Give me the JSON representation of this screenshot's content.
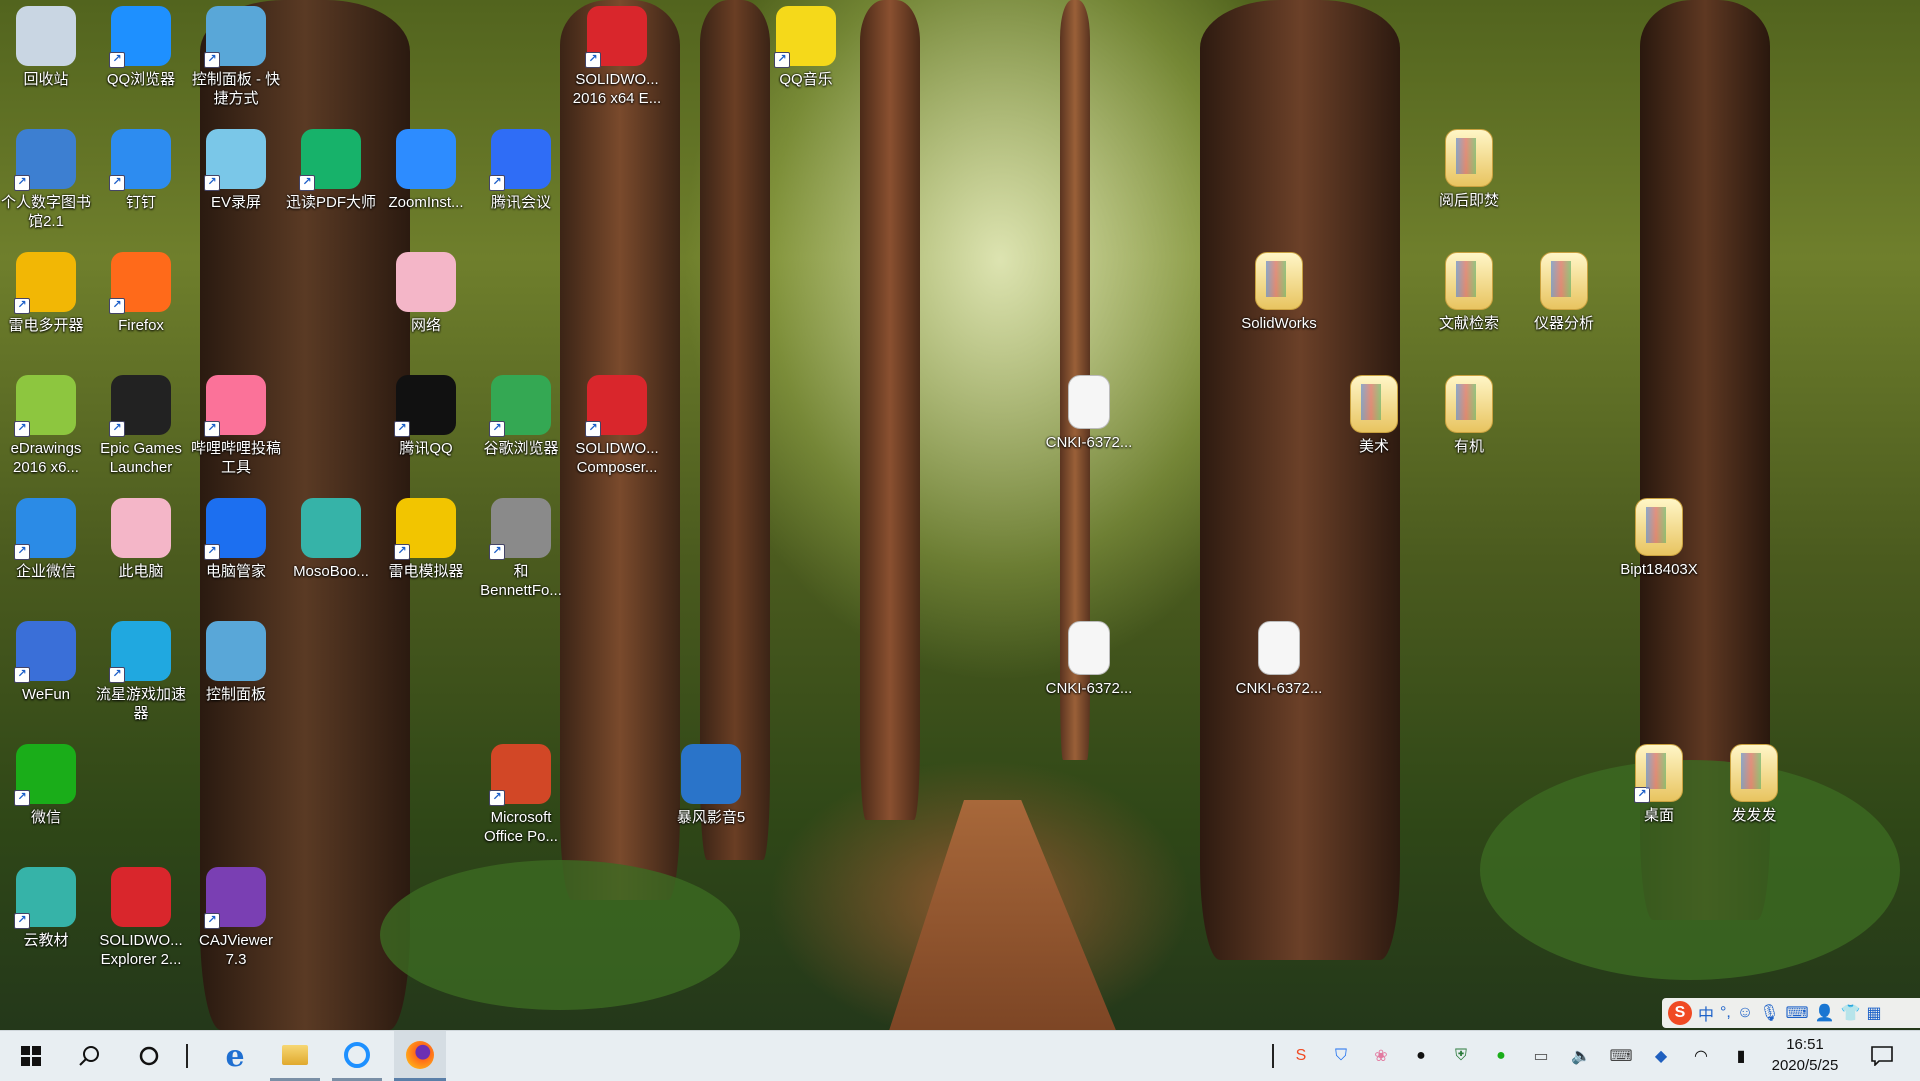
{
  "desktop": {
    "icons": [
      {
        "label": "回收站",
        "icon": "recycle-bin-icon",
        "color": "#c9d6e3",
        "shortcut": false
      },
      {
        "label": "QQ浏览器",
        "icon": "qq-browser-icon",
        "color": "#1e90ff",
        "shortcut": true
      },
      {
        "label": "控制面板 - 快捷方式",
        "icon": "control-panel-icon",
        "color": "#59a7d8",
        "shortcut": true
      },
      {
        "label": "SOLIDWO... 2016 x64 E...",
        "icon": "solidworks-icon",
        "color": "#d9262c",
        "shortcut": true
      },
      {
        "label": "QQ音乐",
        "icon": "qq-music-icon",
        "color": "#f5d91a",
        "shortcut": true
      },
      {
        "label": "个人数字图书馆2.1",
        "icon": "digital-library-icon",
        "color": "#3d7fd1",
        "shortcut": true
      },
      {
        "label": "钉钉",
        "icon": "dingtalk-icon",
        "color": "#2d8cf0",
        "shortcut": true
      },
      {
        "label": "EV录屏",
        "icon": "ev-recorder-icon",
        "color": "#7ac7e8",
        "shortcut": true
      },
      {
        "label": "迅读PDF大师",
        "icon": "pdf-reader-icon",
        "color": "#17b26a",
        "shortcut": true
      },
      {
        "label": "ZoomInst...",
        "icon": "zoom-icon",
        "color": "#2d8cff",
        "shortcut": false
      },
      {
        "label": "腾讯会议",
        "icon": "tencent-meeting-icon",
        "color": "#2f6df6",
        "shortcut": true
      },
      {
        "label": "阅后即焚",
        "icon": "folder-icon",
        "color": "#e8c460",
        "shortcut": false
      },
      {
        "label": "雷电多开器",
        "icon": "ldplayer-multi-icon",
        "color": "#f2b705",
        "shortcut": true
      },
      {
        "label": "Firefox",
        "icon": "firefox-icon",
        "color": "#ff6a1a",
        "shortcut": true
      },
      {
        "label": "网络",
        "icon": "network-anime-icon",
        "color": "#f4b6c8",
        "shortcut": false
      },
      {
        "label": "SolidWorks",
        "icon": "folder-icon",
        "color": "#e8c460",
        "shortcut": false
      },
      {
        "label": "文献检索",
        "icon": "folder-icon",
        "color": "#e8c460",
        "shortcut": false
      },
      {
        "label": "仪器分析",
        "icon": "folder-icon",
        "color": "#e8c460",
        "shortcut": false
      },
      {
        "label": "eDrawings 2016 x6...",
        "icon": "edrawings-icon",
        "color": "#8dc63f",
        "shortcut": true
      },
      {
        "label": "Epic Games Launcher",
        "icon": "epic-games-icon",
        "color": "#222222",
        "shortcut": true
      },
      {
        "label": "哔哩哔哩投稿工具",
        "icon": "bilibili-icon",
        "color": "#fb7299",
        "shortcut": true
      },
      {
        "label": "腾讯QQ",
        "icon": "qq-penguin-icon",
        "color": "#111111",
        "shortcut": true
      },
      {
        "label": "谷歌浏览器",
        "icon": "chrome-icon",
        "color": "#34a853",
        "shortcut": true
      },
      {
        "label": "SOLIDWO... Composer...",
        "icon": "solidworks-composer-icon",
        "color": "#d9262c",
        "shortcut": true
      },
      {
        "label": "CNKI-6372...",
        "icon": "document-icon",
        "color": "#f6f6f6",
        "shortcut": false
      },
      {
        "label": "美术",
        "icon": "folder-icon",
        "color": "#e8c460",
        "shortcut": false
      },
      {
        "label": "有机",
        "icon": "folder-icon",
        "color": "#e8c460",
        "shortcut": false
      },
      {
        "label": "企业微信",
        "icon": "wecom-icon",
        "color": "#2b8be6",
        "shortcut": true
      },
      {
        "label": "此电脑",
        "icon": "this-pc-anime-icon",
        "color": "#f4b6c8",
        "shortcut": false
      },
      {
        "label": "电脑管家",
        "icon": "pc-manager-icon",
        "color": "#1c6ff0",
        "shortcut": true
      },
      {
        "label": "MosoBoo...",
        "icon": "mosobook-icon",
        "color": "#36b3a8",
        "shortcut": false
      },
      {
        "label": "雷电模拟器",
        "icon": "ldplayer-icon",
        "color": "#f2c500",
        "shortcut": true
      },
      {
        "label": "和 BennettFo...",
        "icon": "bennett-icon",
        "color": "#8a8a8a",
        "shortcut": true
      },
      {
        "label": "Bipt18403X",
        "icon": "folder-icon",
        "color": "#e8c460",
        "shortcut": false
      },
      {
        "label": "WeFun",
        "icon": "wefun-icon",
        "color": "#3a6fd8",
        "shortcut": true
      },
      {
        "label": "流星游戏加速器",
        "icon": "meteor-accelerator-icon",
        "color": "#20a8e0",
        "shortcut": true
      },
      {
        "label": "控制面板",
        "icon": "control-panel-icon",
        "color": "#59a7d8",
        "shortcut": false
      },
      {
        "label": "CNKI-6372...",
        "icon": "document-icon",
        "color": "#f6f6f6",
        "shortcut": false
      },
      {
        "label": "CNKI-6372...",
        "icon": "document-icon",
        "color": "#f6f6f6",
        "shortcut": false
      },
      {
        "label": "微信",
        "icon": "wechat-icon",
        "color": "#1aad19",
        "shortcut": true
      },
      {
        "label": "Microsoft Office Po...",
        "icon": "powerpoint-icon",
        "color": "#d24726",
        "shortcut": true
      },
      {
        "label": "暴风影音5",
        "icon": "baofeng-icon",
        "color": "#2a74c9",
        "shortcut": false
      },
      {
        "label": "桌面",
        "icon": "folder-icon",
        "color": "#e8c460",
        "shortcut": true
      },
      {
        "label": "发发发",
        "icon": "folder-icon",
        "color": "#e8c460",
        "shortcut": false
      },
      {
        "label": "云教材",
        "icon": "cloud-textbook-icon",
        "color": "#36b3a8",
        "shortcut": true
      },
      {
        "label": "SOLIDWO... Explorer 2...",
        "icon": "solidworks-explorer-icon",
        "color": "#d9262c",
        "shortcut": false
      },
      {
        "label": "CAJViewer 7.3",
        "icon": "cajviewer-icon",
        "color": "#7a3fb3",
        "shortcut": true
      }
    ]
  },
  "taskbar": {
    "pinned": [
      {
        "name": "start-button",
        "icon": "windows-logo-icon"
      },
      {
        "name": "search-button",
        "icon": "search-icon"
      },
      {
        "name": "cortana-button",
        "icon": "cortana-circle-icon"
      },
      {
        "name": "edge-button",
        "icon": "edge-icon"
      },
      {
        "name": "file-explorer-button",
        "icon": "folder-icon"
      },
      {
        "name": "qq-browser-button",
        "icon": "qq-browser-icon"
      },
      {
        "name": "firefox-button",
        "icon": "firefox-icon"
      }
    ],
    "tray_icons": [
      "sogou-input-icon",
      "pc-manager-shield-icon",
      "anime-icon",
      "qq-icon",
      "security-shield-icon",
      "wechat-icon",
      "monitor-icon",
      "volume-icon",
      "keyboard-icon",
      "network-shield-icon",
      "wifi-icon",
      "battery-icon"
    ],
    "clock": {
      "time": "16:51",
      "date": "2020/5/25"
    },
    "ime": {
      "lang": "中",
      "punct": "°,",
      "icons": [
        "smiley-icon",
        "microphone-icon",
        "keyboard-icon",
        "user-icon",
        "shirt-icon",
        "grid-icon"
      ]
    }
  }
}
